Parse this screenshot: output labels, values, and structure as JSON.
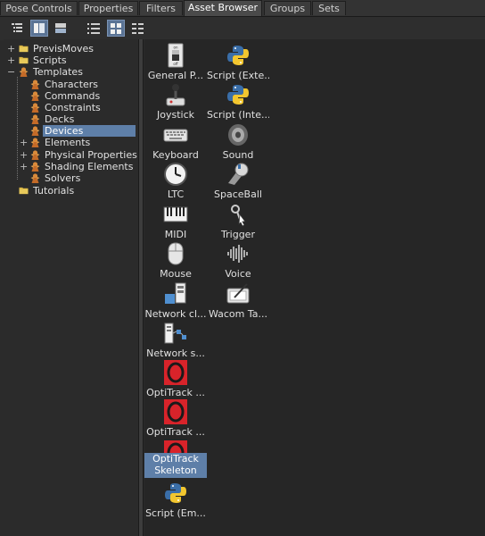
{
  "tabs": [
    {
      "label": "Pose Controls"
    },
    {
      "label": "Properties"
    },
    {
      "label": "Filters"
    },
    {
      "label": "Asset Browser",
      "active": true
    },
    {
      "label": "Groups"
    },
    {
      "label": "Sets"
    }
  ],
  "toolbar": {
    "buttons": [
      "tree-view-icon",
      "split-view-icon",
      "stacked-view-icon",
      "list-view-icon",
      "large-icon-view-icon",
      "details-view-icon"
    ],
    "active": [
      "split-view-icon",
      "large-icon-view-icon"
    ]
  },
  "tree": {
    "items": [
      {
        "label": "PrevisMoves",
        "icon": "folder-icon",
        "expander": "+"
      },
      {
        "label": "Scripts",
        "icon": "folder-icon",
        "expander": "+"
      },
      {
        "label": "Templates",
        "icon": "template-icon",
        "expander": "−"
      },
      {
        "label": "Characters",
        "icon": "template-icon"
      },
      {
        "label": "Commands",
        "icon": "template-icon"
      },
      {
        "label": "Constraints",
        "icon": "template-icon"
      },
      {
        "label": "Decks",
        "icon": "template-icon"
      },
      {
        "label": "Devices",
        "icon": "template-icon",
        "selected": true
      },
      {
        "label": "Elements",
        "icon": "template-icon",
        "expander": "+"
      },
      {
        "label": "Physical Properties",
        "icon": "template-icon",
        "expander": "+"
      },
      {
        "label": "Shading Elements",
        "icon": "template-icon",
        "expander": "+"
      },
      {
        "label": "Solvers",
        "icon": "template-icon"
      },
      {
        "label": "Tutorials",
        "icon": "folder-icon"
      }
    ]
  },
  "assets": [
    {
      "label": "General P...",
      "icon": "switch-icon"
    },
    {
      "label": "Script (Exte...",
      "icon": "python-icon"
    },
    {
      "label": "Joystick",
      "icon": "joystick-icon"
    },
    {
      "label": "Script (Inte...",
      "icon": "python-icon"
    },
    {
      "label": "Keyboard",
      "icon": "keyboard-icon"
    },
    {
      "label": "Sound",
      "icon": "speaker-icon"
    },
    {
      "label": "LTC",
      "icon": "clock-icon"
    },
    {
      "label": "SpaceBall",
      "icon": "spaceball-icon"
    },
    {
      "label": "MIDI",
      "icon": "piano-icon"
    },
    {
      "label": "Trigger",
      "icon": "key-icon"
    },
    {
      "label": "Mouse",
      "icon": "mouse-icon"
    },
    {
      "label": "Voice",
      "icon": "waveform-icon"
    },
    {
      "label": "Network cl...",
      "icon": "network-client-icon"
    },
    {
      "label": "Wacom Ta...",
      "icon": "tablet-icon"
    },
    {
      "label": "Network s...",
      "icon": "network-server-icon"
    },
    {
      "label": "OptiTrack ...",
      "icon": "optitrack-icon"
    },
    {
      "label": "OptiTrack ...",
      "icon": "optitrack-icon"
    },
    {
      "label": "OptiTrack Skeleton",
      "icon": "optitrack-icon",
      "selected": true
    },
    {
      "label": "Script (Em...",
      "icon": "python-icon"
    }
  ],
  "colors": {
    "selection": "#5e7fa8",
    "optitrack_red": "#d8232a"
  }
}
